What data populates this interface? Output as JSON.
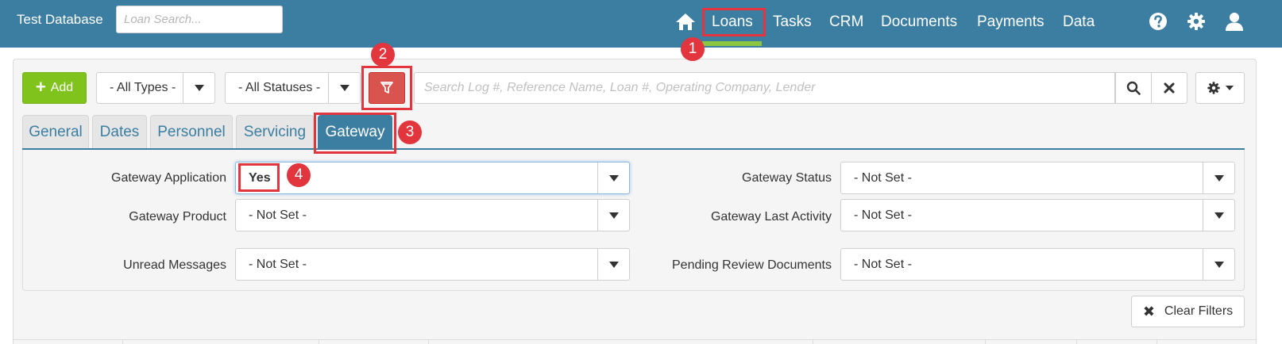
{
  "header": {
    "brand": "Test Database",
    "loan_search_placeholder": "Loan Search...",
    "nav": [
      {
        "label": "Loans",
        "active": true
      },
      {
        "label": "Tasks"
      },
      {
        "label": "CRM"
      },
      {
        "label": "Documents"
      },
      {
        "label": "Payments"
      },
      {
        "label": "Data"
      }
    ],
    "icons": [
      "home-icon",
      "help-icon",
      "gear-icon",
      "user-icon"
    ]
  },
  "toolbar": {
    "add_label": "Add",
    "types_value": "- All Types -",
    "statuses_value": "- All Statuses -",
    "search_placeholder": "Search Log #, Reference Name, Loan #, Operating Company, Lender"
  },
  "tabs": [
    {
      "label": "General"
    },
    {
      "label": "Dates"
    },
    {
      "label": "Personnel"
    },
    {
      "label": "Servicing"
    },
    {
      "label": "Gateway",
      "active": true
    }
  ],
  "filters": {
    "gateway_application": {
      "label": "Gateway Application",
      "value": "Yes"
    },
    "gateway_product": {
      "label": "Gateway Product",
      "value": "- Not Set -"
    },
    "unread_messages": {
      "label": "Unread Messages",
      "value": "- Not Set -"
    },
    "gateway_status": {
      "label": "Gateway Status",
      "value": "- Not Set -"
    },
    "gateway_last_activity": {
      "label": "Gateway Last Activity",
      "value": "- Not Set -"
    },
    "pending_review_documents": {
      "label": "Pending Review Documents",
      "value": "- Not Set -"
    }
  },
  "clear_filters_label": "Clear Filters",
  "annotations": [
    {
      "number": "1"
    },
    {
      "number": "2"
    },
    {
      "number": "3"
    },
    {
      "number": "4"
    }
  ],
  "colors": {
    "header_bg": "#3b7ea1",
    "accent_green": "#8cc63f",
    "add_button": "#7fc31c",
    "filter_button": "#d9534f",
    "annotation_red": "#e2353d"
  }
}
